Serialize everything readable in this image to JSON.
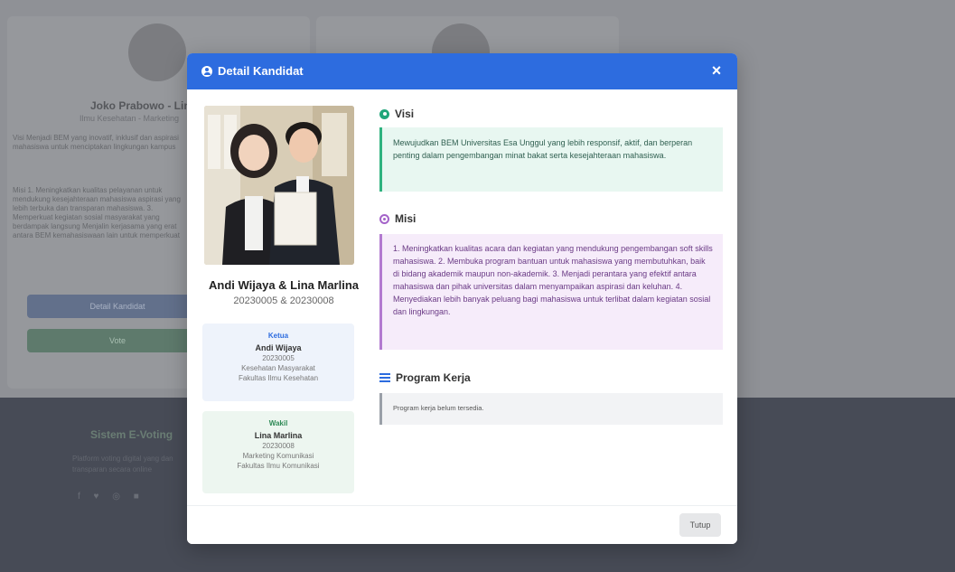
{
  "background": {
    "candidate_name": "Joko Prabowo - Lina",
    "candidate_sub": "Ilmu Kesehatan - Marketing",
    "visi_text": "Visi Menjadi BEM yang inovatif, inklusif dan aspirasi mahasiswa untuk menciptakan lingkungan kampus",
    "misi_text": "Misi 1. Meningkatkan kualitas pelayanan untuk mendukung kesejahteraan mahasiswa aspirasi yang lebih terbuka dan transparan mahasiswa. 3. Memperkuat kegiatan sosial masyarakat yang berdampak langsung Menjalin kerjasama yang erat antara BEM kemahasiswaan lain untuk memperkuat",
    "detail_button": "Detail Kandidat",
    "vote_button": "Vote",
    "footer_title": "Sistem E-Voting",
    "footer_text": "Platform voting digital yang dan transparan secara online"
  },
  "modal": {
    "title": "Detail Kandidat",
    "close_label": "×",
    "candidate": {
      "name": "Andi Wijaya & Lina Marlina",
      "nim": "20230005 & 20230008"
    },
    "ketua": {
      "label": "Ketua",
      "name": "Andi Wijaya",
      "nim": "20230005",
      "prodi": "Kesehatan Masyarakat",
      "fakultas": "Fakultas Ilmu Kesehatan"
    },
    "wakil": {
      "label": "Wakil",
      "name": "Lina Marlina",
      "nim": "20230008",
      "prodi": "Marketing Komunikasi",
      "fakultas": "Fakultas Ilmu Komunikasi"
    },
    "visi": {
      "title": "Visi",
      "text": "Mewujudkan BEM Universitas Esa Unggul yang lebih responsif, aktif, dan berperan penting dalam pengembangan minat bakat serta kesejahteraan mahasiswa."
    },
    "misi": {
      "title": "Misi",
      "text": "1. Meningkatkan kualitas acara dan kegiatan yang mendukung pengembangan soft skills mahasiswa. 2. Membuka program bantuan untuk mahasiswa yang membutuhkan, baik di bidang akademik maupun non-akademik. 3. Menjadi perantara yang efektif antara mahasiswa dan pihak universitas dalam menyampaikan aspirasi dan keluhan. 4. Menyediakan lebih banyak peluang bagi mahasiswa untuk terlibat dalam kegiatan sosial dan lingkungan."
    },
    "program": {
      "title": "Program Kerja",
      "text": "Program kerja belum tersedia."
    },
    "footer": {
      "close_button": "Tutup"
    }
  },
  "colors": {
    "header": "#2d6cdf",
    "visi_accent": "#2fb27f",
    "misi_accent": "#b27ad0",
    "overlay": "#888b90"
  },
  "icons": {
    "header": "user-circle-icon",
    "visi": "eye-icon",
    "misi": "bullseye-icon",
    "program": "list-icon"
  }
}
